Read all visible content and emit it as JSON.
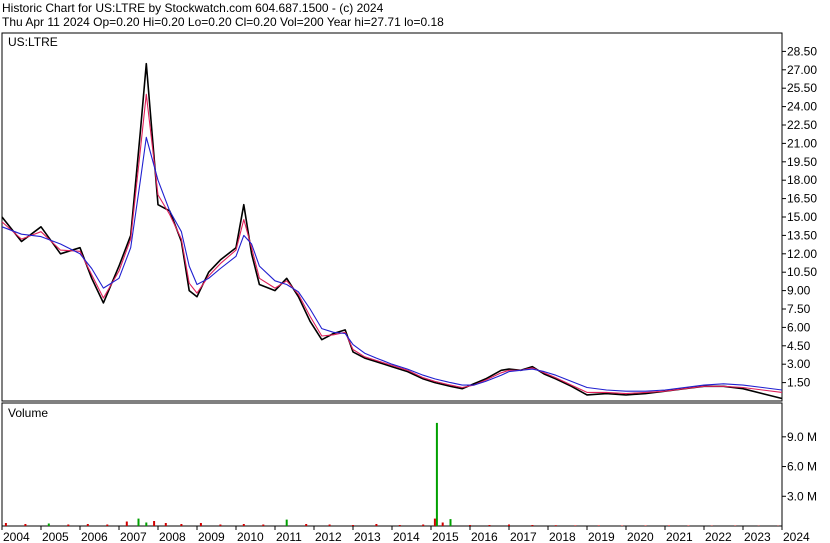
{
  "header": {
    "line1": "Historic Chart for US:LTRE by Stockwatch.com 604.687.1500 - (c) 2024",
    "line2": "Thu Apr 11 2024   Op=0.20  Hi=0.20  Lo=0.20  Cl=0.20  Vol=200   Year hi=27.71   lo=0.18"
  },
  "chart_data": [
    {
      "type": "line",
      "title": "US:LTRE",
      "ylim": [
        0,
        30
      ],
      "yticks": [
        "1.50",
        "3.00",
        "4.50",
        "6.00",
        "7.50",
        "9.00",
        "10.50",
        "12.00",
        "13.50",
        "15.00",
        "16.50",
        "18.00",
        "19.50",
        "21.00",
        "22.50",
        "24.00",
        "25.50",
        "27.00",
        "28.50"
      ],
      "x": [
        2004.0,
        2004.5,
        2005.0,
        2005.5,
        2006.0,
        2006.3,
        2006.6,
        2007.0,
        2007.3,
        2007.55,
        2007.7,
        2008.0,
        2008.3,
        2008.6,
        2008.8,
        2009.0,
        2009.3,
        2009.6,
        2010.0,
        2010.2,
        2010.4,
        2010.6,
        2011.0,
        2011.3,
        2011.6,
        2011.9,
        2012.2,
        2012.5,
        2012.8,
        2013.0,
        2013.3,
        2013.6,
        2014.0,
        2014.4,
        2014.8,
        2015.1,
        2015.5,
        2015.8,
        2016.1,
        2016.4,
        2016.8,
        2017.0,
        2017.3,
        2017.6,
        2017.9,
        2018.2,
        2018.6,
        2019.0,
        2019.5,
        2020.0,
        2020.5,
        2021.0,
        2021.5,
        2022.0,
        2022.5,
        2023.0,
        2023.5,
        2024.0
      ],
      "series": [
        {
          "color": "#000000",
          "values": [
            15.0,
            13.0,
            14.2,
            12.0,
            12.5,
            10.0,
            8.0,
            11.0,
            13.5,
            22.0,
            27.5,
            16.0,
            15.5,
            13.0,
            9.0,
            8.5,
            10.5,
            11.5,
            12.5,
            16.0,
            12.0,
            9.5,
            9.0,
            10.0,
            8.5,
            6.5,
            5.0,
            5.5,
            5.8,
            4.0,
            3.5,
            3.2,
            2.8,
            2.4,
            1.8,
            1.5,
            1.2,
            1.0,
            1.4,
            1.8,
            2.5,
            2.6,
            2.5,
            2.8,
            2.2,
            1.8,
            1.2,
            0.5,
            0.6,
            0.5,
            0.6,
            0.8,
            1.0,
            1.2,
            1.2,
            1.0,
            0.6,
            0.2
          ]
        },
        {
          "color": "#e0205a",
          "values": [
            14.6,
            13.2,
            13.8,
            12.3,
            12.2,
            10.3,
            8.4,
            10.6,
            13.2,
            20.5,
            25.0,
            16.8,
            15.2,
            13.2,
            9.6,
            8.8,
            10.2,
            11.2,
            12.3,
            14.8,
            12.5,
            10.0,
            9.2,
            9.8,
            8.7,
            6.9,
            5.3,
            5.4,
            5.6,
            4.2,
            3.6,
            3.3,
            2.9,
            2.5,
            1.9,
            1.6,
            1.3,
            1.1,
            1.3,
            1.7,
            2.3,
            2.5,
            2.5,
            2.7,
            2.3,
            1.9,
            1.3,
            0.7,
            0.7,
            0.6,
            0.7,
            0.8,
            1.0,
            1.2,
            1.2,
            1.1,
            0.9,
            0.7
          ]
        },
        {
          "color": "#2020d0",
          "values": [
            14.2,
            13.6,
            13.4,
            12.8,
            12.0,
            10.8,
            9.2,
            10.0,
            12.5,
            18.0,
            21.5,
            18.0,
            15.5,
            13.8,
            11.0,
            9.5,
            10.0,
            10.8,
            11.8,
            13.5,
            12.8,
            11.0,
            9.8,
            9.5,
            8.9,
            7.5,
            5.9,
            5.6,
            5.5,
            4.6,
            3.9,
            3.5,
            3.0,
            2.6,
            2.1,
            1.8,
            1.5,
            1.3,
            1.3,
            1.6,
            2.1,
            2.4,
            2.5,
            2.6,
            2.4,
            2.1,
            1.6,
            1.1,
            0.9,
            0.8,
            0.8,
            0.9,
            1.1,
            1.3,
            1.4,
            1.3,
            1.1,
            0.9
          ]
        }
      ]
    },
    {
      "type": "bar",
      "title": "Volume",
      "ylim": [
        0,
        11000000
      ],
      "yticks": [
        "3.0 M",
        "6.0 M",
        "9.0 M"
      ],
      "x": [
        2004.1,
        2004.6,
        2005.2,
        2005.7,
        2006.2,
        2006.7,
        2007.2,
        2007.5,
        2007.7,
        2007.9,
        2008.2,
        2008.6,
        2009.1,
        2009.6,
        2010.2,
        2010.7,
        2011.3,
        2011.8,
        2012.4,
        2013.0,
        2013.6,
        2014.2,
        2014.8,
        2015.1,
        2015.15,
        2015.3,
        2015.5,
        2016.0,
        2016.5,
        2017.0,
        2017.6,
        2018.2,
        2018.7,
        2019.3,
        2019.9,
        2020.5,
        2021.1,
        2021.6,
        2022.2,
        2022.8,
        2023.4,
        2023.9
      ],
      "values": [
        300000,
        200000,
        250000,
        150000,
        200000,
        150000,
        450000,
        750000,
        350000,
        500000,
        300000,
        200000,
        300000,
        150000,
        200000,
        150000,
        650000,
        200000,
        150000,
        100000,
        200000,
        100000,
        150000,
        750000,
        10400000,
        350000,
        700000,
        100000,
        100000,
        150000,
        100000,
        80000,
        60000,
        60000,
        50000,
        50000,
        60000,
        50000,
        40000,
        40000,
        30000,
        30000
      ],
      "colors": [
        "#d00000",
        "#d00000",
        "#00a000",
        "#d00000",
        "#d00000",
        "#d00000",
        "#d00000",
        "#00a000",
        "#00a000",
        "#d00000",
        "#d00000",
        "#d00000",
        "#d00000",
        "#d00000",
        "#d00000",
        "#d00000",
        "#00a000",
        "#d00000",
        "#d00000",
        "#d00000",
        "#d00000",
        "#d00000",
        "#d00000",
        "#d00000",
        "#00a000",
        "#d00000",
        "#00a000",
        "#d00000",
        "#d00000",
        "#d00000",
        "#d00000",
        "#d00000",
        "#d00000",
        "#d00000",
        "#d00000",
        "#d00000",
        "#d00000",
        "#d00000",
        "#d00000",
        "#d00000",
        "#d00000",
        "#d00000"
      ]
    }
  ],
  "xaxis": {
    "min": 2004.0,
    "max": 2024.0,
    "labels": [
      "2004",
      "2005",
      "2006",
      "2007",
      "2008",
      "2009",
      "2010",
      "2011",
      "2012",
      "2013",
      "2014",
      "2015",
      "2016",
      "2017",
      "2018",
      "2019",
      "2020",
      "2021",
      "2022",
      "2023",
      "2024"
    ]
  }
}
